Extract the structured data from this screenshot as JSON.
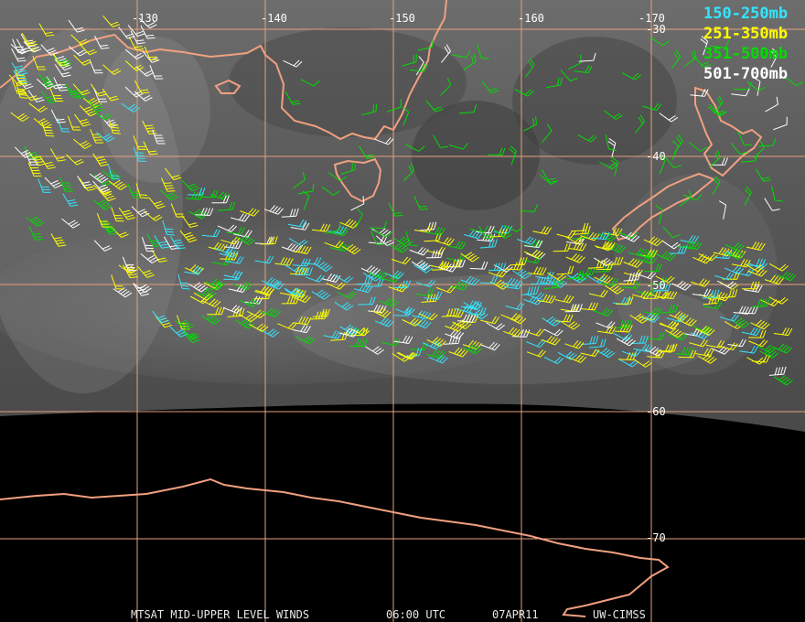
{
  "colors": {
    "background": "#000000",
    "grid": "#e6a07a",
    "coast": "#f0a080",
    "cyan": "#33e5ff",
    "yellow": "#ffff00",
    "green": "#00dd00",
    "white": "#ffffff"
  },
  "longitude_labels": [
    "-130",
    "-140",
    "-150",
    "-160",
    "-170"
  ],
  "latitude_labels": [
    "-30",
    "-40",
    "-50",
    "-60",
    "-70"
  ],
  "legend": [
    {
      "label": "150-250mb",
      "color": "#33e5ff"
    },
    {
      "label": "251-350mb",
      "color": "#ffff00"
    },
    {
      "label": "351-500mb",
      "color": "#00dd00"
    },
    {
      "label": "501-700mb",
      "color": "#ffffff"
    }
  ],
  "footer": {
    "title": "MTSAT MID-UPPER LEVEL WINDS",
    "time": "06:00 UTC",
    "date": "07APR11",
    "source": "UW-CIMSS"
  }
}
